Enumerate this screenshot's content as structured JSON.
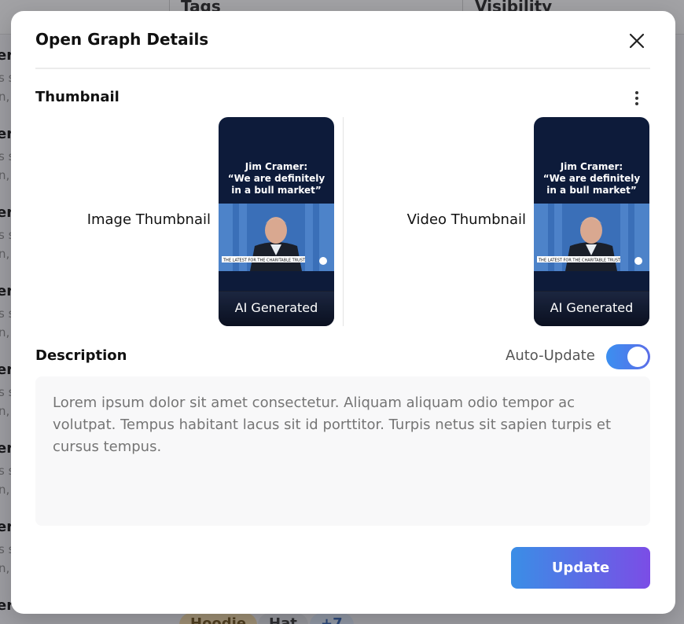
{
  "background": {
    "columns": [
      {
        "title": "Tags"
      },
      {
        "title": "Visibility"
      }
    ],
    "rows": [
      {
        "title": "er",
        "sub1": "s s",
        "sub2": "n, p"
      },
      {
        "title": "er",
        "sub1": "s s",
        "sub2": "n, p"
      },
      {
        "title": "er",
        "sub1": "s s",
        "sub2": "n, p"
      },
      {
        "title": "er",
        "sub1": "s s",
        "sub2": "n, p"
      },
      {
        "title": "er",
        "sub1": "s s",
        "sub2": "n, p"
      },
      {
        "title": "er",
        "sub1": "s s",
        "sub2": "n, p"
      },
      {
        "title": "er",
        "sub1": "s s",
        "sub2": "n, p"
      },
      {
        "title": "er"
      }
    ],
    "tags": [
      "Hoodie",
      "Hat",
      "+7"
    ]
  },
  "modal": {
    "title": "Open Graph Details",
    "close_icon": "close-icon",
    "thumbnail_section": {
      "label": "Thumbnail",
      "menu_icon": "kebab-menu-icon",
      "items": [
        {
          "label": "Image Thumbnail",
          "quote_line1": "Jim Cramer:",
          "quote_line2": "“We are definitely",
          "quote_line3": "in a bull market”",
          "caption": "THE LATEST FOR THE CHARITABLE TRUST",
          "badge": "AI Generated"
        },
        {
          "label": "Video Thumbnail",
          "quote_line1": "Jim Cramer:",
          "quote_line2": "“We are definitely",
          "quote_line3": "in a bull market”",
          "caption": "THE LATEST FOR THE CHARITABLE TRUST",
          "badge": "AI Generated"
        }
      ]
    },
    "description_section": {
      "label": "Description",
      "auto_update_label": "Auto-Update",
      "auto_update_on": true,
      "placeholder": "Lorem ipsum dolor sit amet consectetur. Aliquam aliquam odio tempor ac volutpat. Tempus habitant lacus sit id porttitor. Turpis netus sit sapien turpis et cursus tempus."
    },
    "update_button": "Update"
  },
  "colors": {
    "accent_start": "#3b8ff0",
    "accent_end": "#7b4de6",
    "thumb_bg": "#0d1b3a"
  }
}
